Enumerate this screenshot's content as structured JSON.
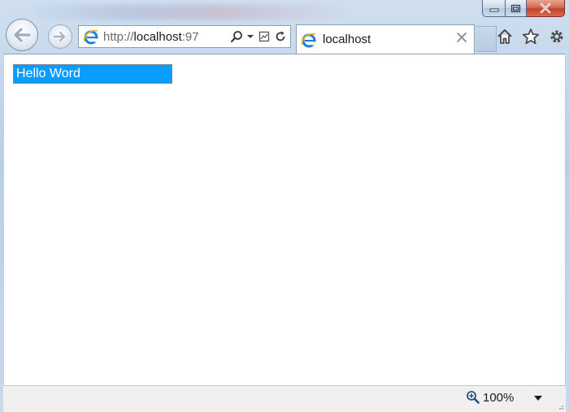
{
  "browser": {
    "address": {
      "scheme": "http://",
      "host": "localhost",
      "port_fragment": ":97"
    },
    "tab": {
      "title": "localhost"
    },
    "icons": {
      "back": "back-arrow-icon",
      "forward": "forward-arrow-icon",
      "search": "search-icon",
      "dropdown": "chevron-down-icon",
      "compat": "compatibility-view-icon",
      "refresh": "refresh-icon",
      "close_tab": "close-icon",
      "home": "home-icon",
      "favorites": "star-icon",
      "tools": "gear-icon",
      "minimize": "minimize-icon",
      "maximize": "maximize-icon",
      "close_window": "close-window-icon",
      "zoom": "zoom-icon"
    }
  },
  "page": {
    "box_text": "Hello Word",
    "box_color": "#0b9cff"
  },
  "status": {
    "zoom": "100%"
  }
}
